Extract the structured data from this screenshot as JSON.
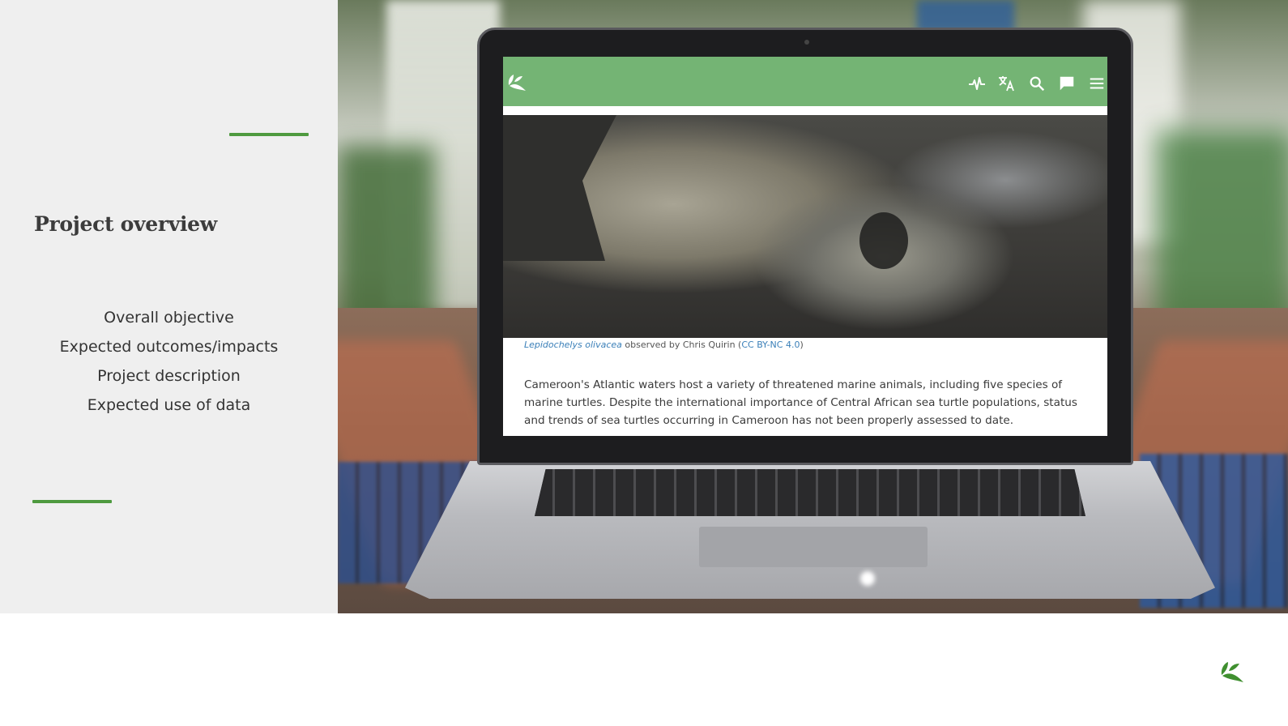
{
  "slide": {
    "title": "Project overview",
    "agenda": [
      "Overall objective",
      "Expected outcomes/impacts",
      "Project description",
      "Expected use of data"
    ]
  },
  "screen": {
    "nav_icons": [
      "activity-icon",
      "translate-icon",
      "search-icon",
      "chat-icon",
      "menu-icon"
    ],
    "caption": {
      "species": "Lepidochelys olivacea",
      "observed_by": " observed by Chris Quirin (",
      "license": "CC BY-NC 4.0",
      "close": ")"
    },
    "body": "Cameroon's Atlantic waters host a variety of threatened marine animals, including five species of marine turtles. Despite the international importance of Central African sea turtle populations, status and trends of sea turtles occurring in Cameroon has not been properly assessed to date."
  },
  "colors": {
    "accent": "#4e9a3f",
    "navbar": "#74b474",
    "link": "#3a7fb8"
  }
}
